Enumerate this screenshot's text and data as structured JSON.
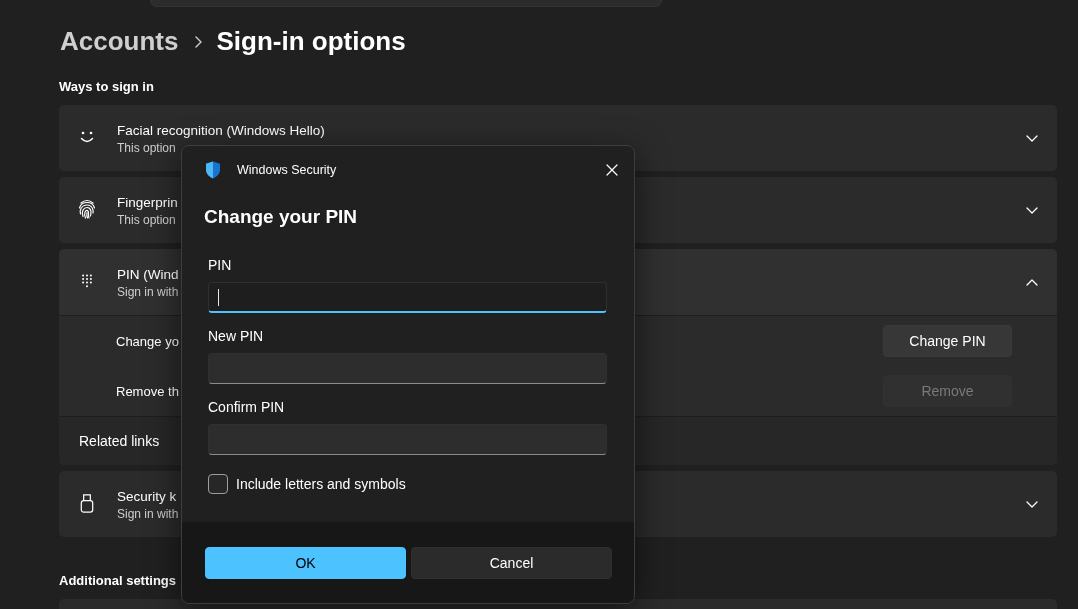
{
  "breadcrumb": [
    {
      "label": "Accounts",
      "current": false
    },
    {
      "label": "Sign-in options",
      "current": true
    }
  ],
  "ways_to_sign_in": {
    "heading": "Ways to sign in",
    "options": [
      {
        "title": "Facial recognition (Windows Hello)",
        "subtitle": "This option",
        "expanded": false
      },
      {
        "title": "Fingerprin",
        "subtitle": "This option",
        "expanded": false
      },
      {
        "title": "PIN (Wind",
        "subtitle": "Sign in with",
        "expanded": true,
        "settings": [
          {
            "label": "Change yo",
            "button": {
              "label": "Change PIN",
              "disabled": false
            }
          },
          {
            "label": "Remove th",
            "button": {
              "label": "Remove",
              "disabled": true
            }
          }
        ],
        "related_links": {
          "label": "Related links"
        }
      },
      {
        "title": "Security k",
        "subtitle": "Sign in with",
        "expanded": false
      }
    ]
  },
  "additional_settings": {
    "heading": "Additional settings"
  },
  "dialog": {
    "app_title": "Windows Security",
    "title": "Change your PIN",
    "fields": [
      {
        "label": "PIN",
        "focused": true
      },
      {
        "label": "New PIN",
        "focused": false
      },
      {
        "label": "Confirm PIN",
        "focused": false
      }
    ],
    "checkbox": {
      "label": "Include letters and symbols",
      "checked": false
    },
    "buttons": [
      {
        "label": "OK",
        "kind": "primary"
      },
      {
        "label": "Cancel",
        "kind": "secondary"
      }
    ]
  }
}
